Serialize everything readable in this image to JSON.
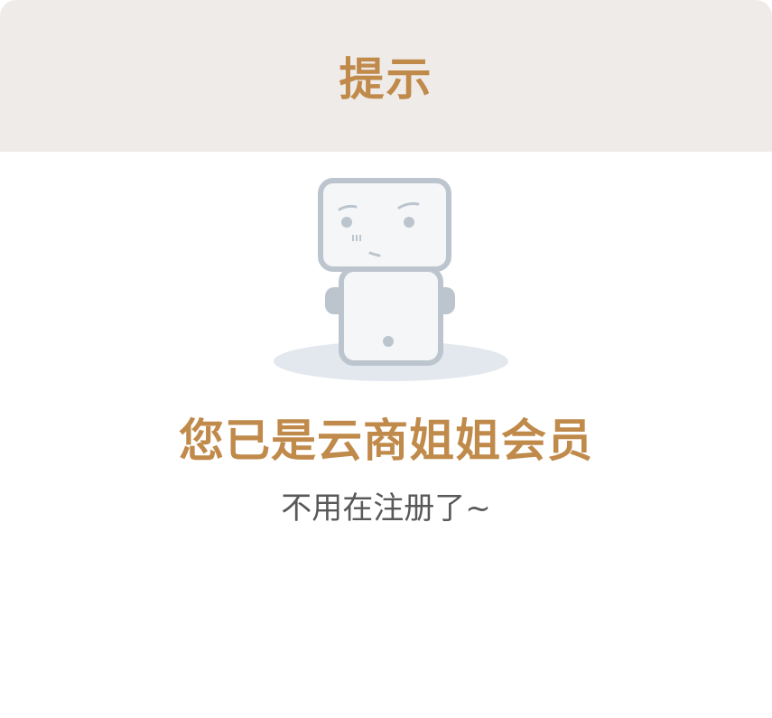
{
  "dialog": {
    "title": "提示",
    "illustration_icon": "robot-icon",
    "message": "您已是云商姐姐会员",
    "sub_message": "不用在注册了~"
  },
  "colors": {
    "accent": "#c08a4b",
    "header_background": "#efebe9",
    "robot_stroke": "#bcc5ce",
    "robot_fill": "#f4f6f8",
    "shadow": "#e2e8ee",
    "sub_text": "#595959"
  }
}
